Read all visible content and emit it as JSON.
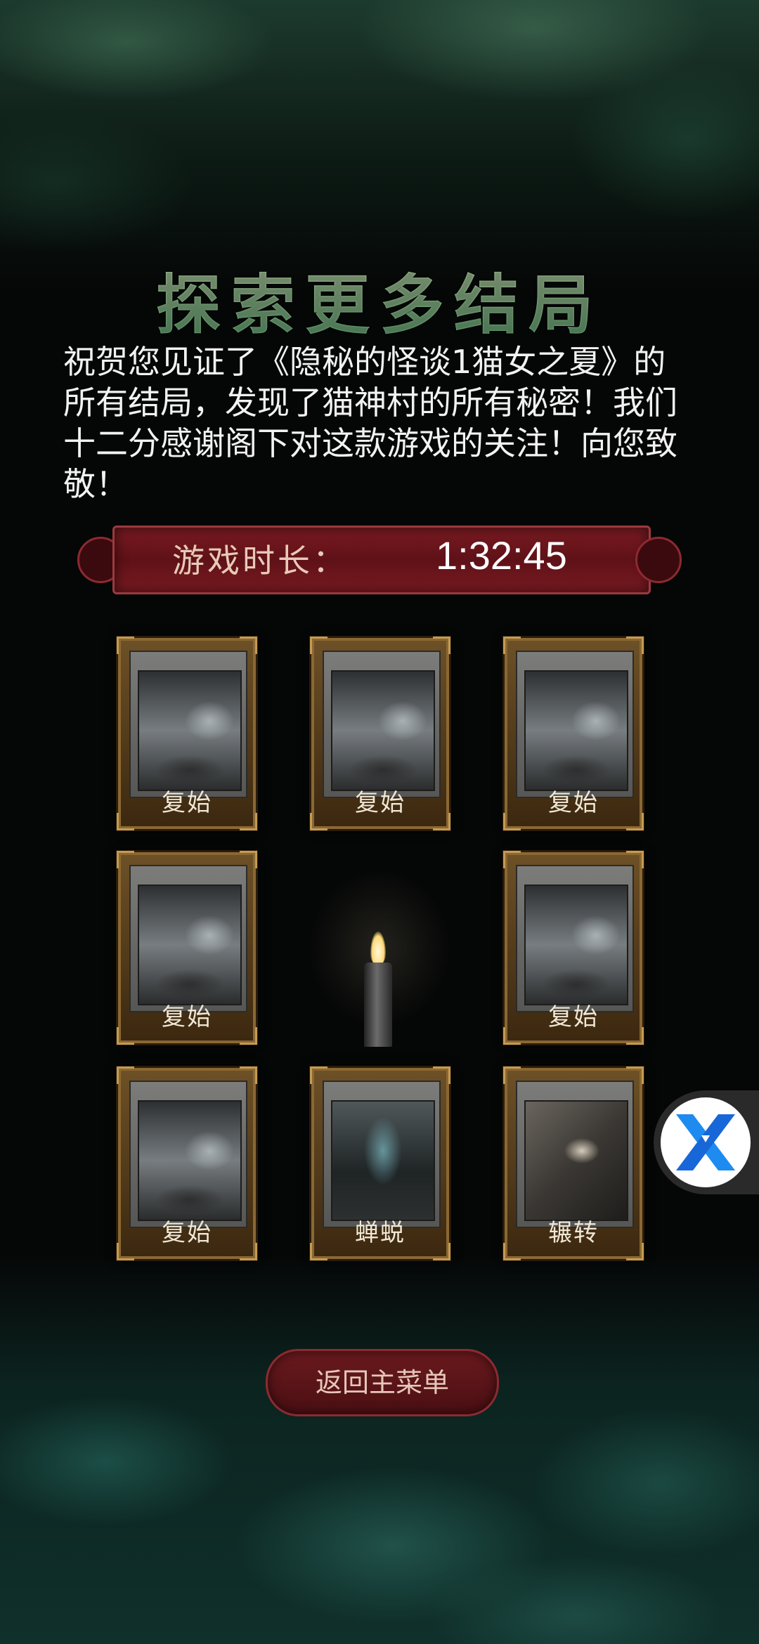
{
  "title": "探索更多结局",
  "message": "祝贺您见证了《隐秘的怪谈1猫女之夏》的所有结局，发现了猫神村的所有秘密！我们十二分感谢阁下对这款游戏的关注！向您致敬！",
  "play_time": {
    "label": "游戏时长：",
    "value": "1:32:45"
  },
  "endings": [
    {
      "name": "复始",
      "art": "misty-forest"
    },
    {
      "name": "复始",
      "art": "misty-forest"
    },
    {
      "name": "复始",
      "art": "misty-forest"
    },
    {
      "name": "复始",
      "art": "misty-forest"
    },
    {
      "name": "复始",
      "art": "misty-forest"
    },
    {
      "name": "复始",
      "art": "misty-forest"
    },
    {
      "name": "蝉蜕",
      "art": "dark-shrine"
    },
    {
      "name": "辗转",
      "art": "open-book"
    }
  ],
  "center_item": "candle-icon",
  "return_button": "返回主菜单",
  "floating_widget_icon": "x-logo-icon",
  "colors": {
    "title_green": "#b8e3a6",
    "banner_red": "#6a1a1e",
    "card_gold": "#8a6833"
  }
}
